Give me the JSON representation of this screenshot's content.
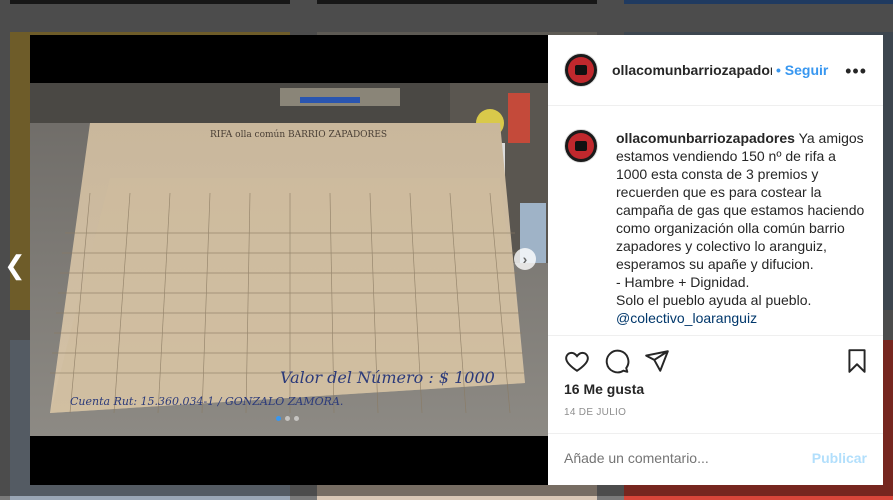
{
  "post": {
    "username": "ollacomunbarriozapadores",
    "username_truncated": "ollacomunbarriozapador",
    "follow_label": "Seguir",
    "follow_separator": "•",
    "more_label": "•••"
  },
  "caption": {
    "username": "ollacomunbarriozapadores",
    "lines": [
      "Ya amigos",
      "estamos vendiendo 150 nº de rifa a",
      "1000 esta consta de 3 premios y",
      "recuerden que es para costear la",
      "campaña de gas que estamos haciendo",
      "como organización olla común barrio",
      "zapadores y colectivo lo aranguiz,",
      "esperamos su apañe y difucion.",
      "- Hambre + Dignidad.",
      "Solo el pueblo ayuda al pueblo."
    ],
    "mention": "@colectivo_loaranguiz"
  },
  "stats": {
    "likes": "16 Me gusta",
    "date": "14 DE JULIO"
  },
  "comment": {
    "placeholder": "Añade un comentario...",
    "publish_label": "Publicar"
  },
  "photo": {
    "title_text": "RIFA olla común BARRIO ZAPADORES",
    "valor_text": "Valor del Número : $ 1000",
    "cuenta_text": "Cuenta Rut: 15.360.034-1 / GONZALO ZAMORA."
  },
  "carousel": {
    "dots": 3,
    "active": 0
  },
  "colors": {
    "link": "#3897f0",
    "publish_disabled": "#b2dffc"
  }
}
